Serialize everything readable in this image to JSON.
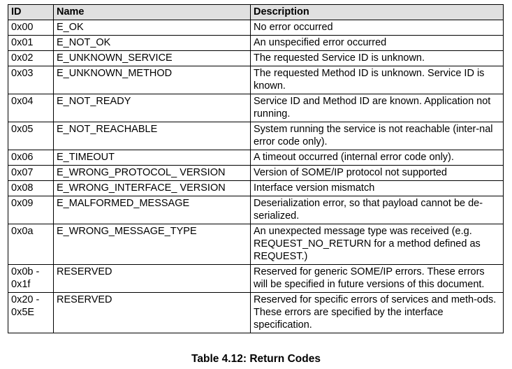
{
  "table": {
    "headers": {
      "id": "ID",
      "name": "Name",
      "description": "Description"
    },
    "rows": [
      {
        "id": "0x00",
        "name": "E_OK",
        "description": "No error occurred"
      },
      {
        "id": "0x01",
        "name": "E_NOT_OK",
        "description": "An unspecified error occurred"
      },
      {
        "id": "0x02",
        "name": "E_UNKNOWN_SERVICE",
        "description": "The requested Service ID is unknown."
      },
      {
        "id": "0x03",
        "name": "E_UNKNOWN_METHOD",
        "description": "The requested Method ID is unknown. Service ID is known."
      },
      {
        "id": "0x04",
        "name": "E_NOT_READY",
        "description": "Service ID and Method ID are known. Application not running."
      },
      {
        "id": "0x05",
        "name": "E_NOT_REACHABLE",
        "description": "System running the service is not reachable (inter-nal error code only)."
      },
      {
        "id": "0x06",
        "name": "E_TIMEOUT",
        "description": "A timeout occurred (internal error code only)."
      },
      {
        "id": "0x07",
        "name": "E_WRONG_PROTOCOL_ VERSION",
        "description": "Version of SOME/IP protocol not supported"
      },
      {
        "id": "0x08",
        "name": "E_WRONG_INTERFACE_ VERSION",
        "description": "Interface version mismatch"
      },
      {
        "id": "0x09",
        "name": "E_MALFORMED_MESSAGE",
        "description": "Deserialization error, so that payload cannot be de-serialized."
      },
      {
        "id": "0x0a",
        "name": "E_WRONG_MESSAGE_TYPE",
        "description": "An unexpected message type was received (e.g. REQUEST_NO_RETURN for a method defined as REQUEST.)"
      },
      {
        "id": "0x0b - 0x1f",
        "name": "RESERVED",
        "description": "Reserved for generic SOME/IP errors. These errors will be specified in future versions of this document."
      },
      {
        "id": "0x20 - 0x5E",
        "name": "RESERVED",
        "description": "Reserved for specific errors of services and meth-ods. These errors are specified by the interface specification."
      }
    ]
  },
  "caption": "Table 4.12: Return Codes"
}
